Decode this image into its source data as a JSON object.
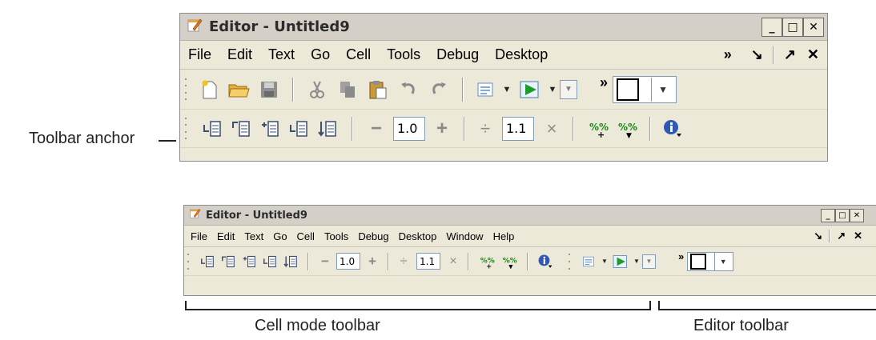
{
  "top_window": {
    "title": "Editor - Untitled9",
    "controls": {
      "minimize": "_",
      "maximize": "□",
      "close": "✕"
    },
    "menu": [
      "File",
      "Edit",
      "Text",
      "Go",
      "Cell",
      "Tools",
      "Debug",
      "Desktop"
    ],
    "menu_overflow": "»",
    "menu_right": {
      "dock": "↘",
      "undock": "↗",
      "close": "✕"
    },
    "editor_toolbar": {
      "overflow": "»"
    },
    "cell_toolbar": {
      "decrement": "−",
      "value1": "1.0",
      "increment": "+",
      "divide": "÷",
      "value2": "1.1",
      "multiply": "×"
    }
  },
  "bottom_window": {
    "title": "Editor - Untitled9",
    "controls": {
      "minimize": "_",
      "maximize": "□",
      "close": "✕"
    },
    "menu": [
      "File",
      "Edit",
      "Text",
      "Go",
      "Cell",
      "Tools",
      "Debug",
      "Desktop",
      "Window",
      "Help"
    ],
    "menu_right": {
      "dock": "↘",
      "undock": "↗",
      "close": "✕"
    },
    "cell_toolbar": {
      "decrement": "−",
      "value1": "1.0",
      "increment": "+",
      "divide": "÷",
      "value2": "1.1",
      "multiply": "×"
    },
    "editor_toolbar": {
      "overflow": "»"
    }
  },
  "callouts": {
    "toolbar_anchor": "Toolbar anchor",
    "cell_mode_toolbar": "Cell mode toolbar",
    "editor_toolbar": "Editor toolbar"
  },
  "icons": [
    "editor-icon",
    "new-file-icon",
    "open-folder-icon",
    "save-icon",
    "cut-icon",
    "copy-icon",
    "paste-icon",
    "undo-icon",
    "redo-icon",
    "comment-icon",
    "run-icon",
    "cell-eval-icon",
    "cell-advance-icon",
    "cell-insert-icon",
    "cell-prev-icon",
    "cell-next-icon",
    "percent-add-icon",
    "percent-insert-icon",
    "info-icon"
  ],
  "colors": {
    "accent_green": "#1b8a1b",
    "window_bg": "#ece9d8",
    "title_bg": "#d4d0c8"
  }
}
